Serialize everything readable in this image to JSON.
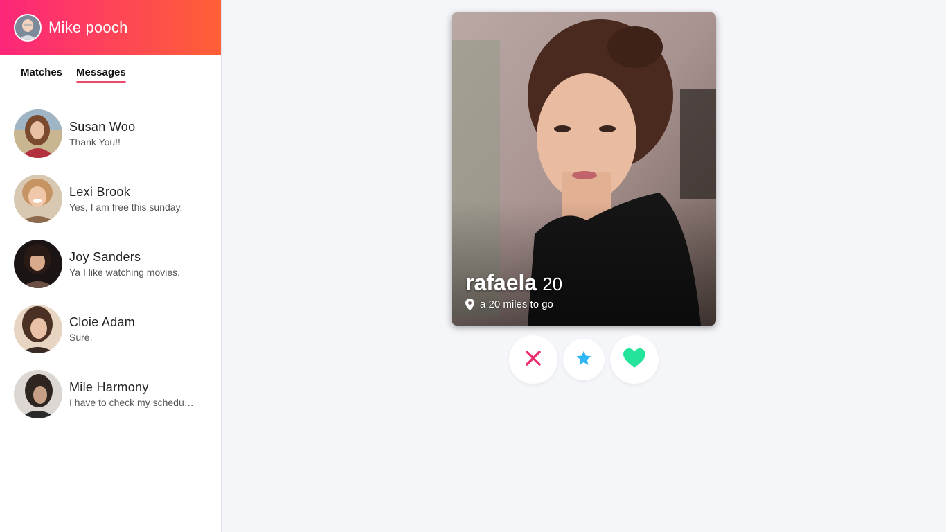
{
  "user": {
    "name": "Mike pooch",
    "avatar_icon": "user-avatar"
  },
  "tabs": [
    {
      "label": "Matches",
      "active": false
    },
    {
      "label": "Messages",
      "active": true
    }
  ],
  "messages": [
    {
      "name": "Susan Woo",
      "preview": "Thank You!!"
    },
    {
      "name": "Lexi Brook",
      "preview": "Yes, I am free this sunday."
    },
    {
      "name": "Joy Sanders",
      "preview": "Ya I like watching movies."
    },
    {
      "name": "Cloie Adam",
      "preview": "Sure."
    },
    {
      "name": "Mile Harmony",
      "preview": "I have to check my schedule."
    }
  ],
  "card": {
    "name": "rafaela",
    "age": "20",
    "distance": "a 20 miles to go",
    "distance_icon": "location-pin-icon"
  },
  "actions": {
    "nope_icon": "close-icon",
    "super_like_icon": "star-icon",
    "like_icon": "heart-icon"
  },
  "colors": {
    "brand_gradient_start": "#fd267a",
    "brand_gradient_end": "#ff6036",
    "tab_underline": "#ec4a6c",
    "nope": "#ec2d70",
    "super_like": "#2db7f5",
    "like": "#24e39a"
  }
}
